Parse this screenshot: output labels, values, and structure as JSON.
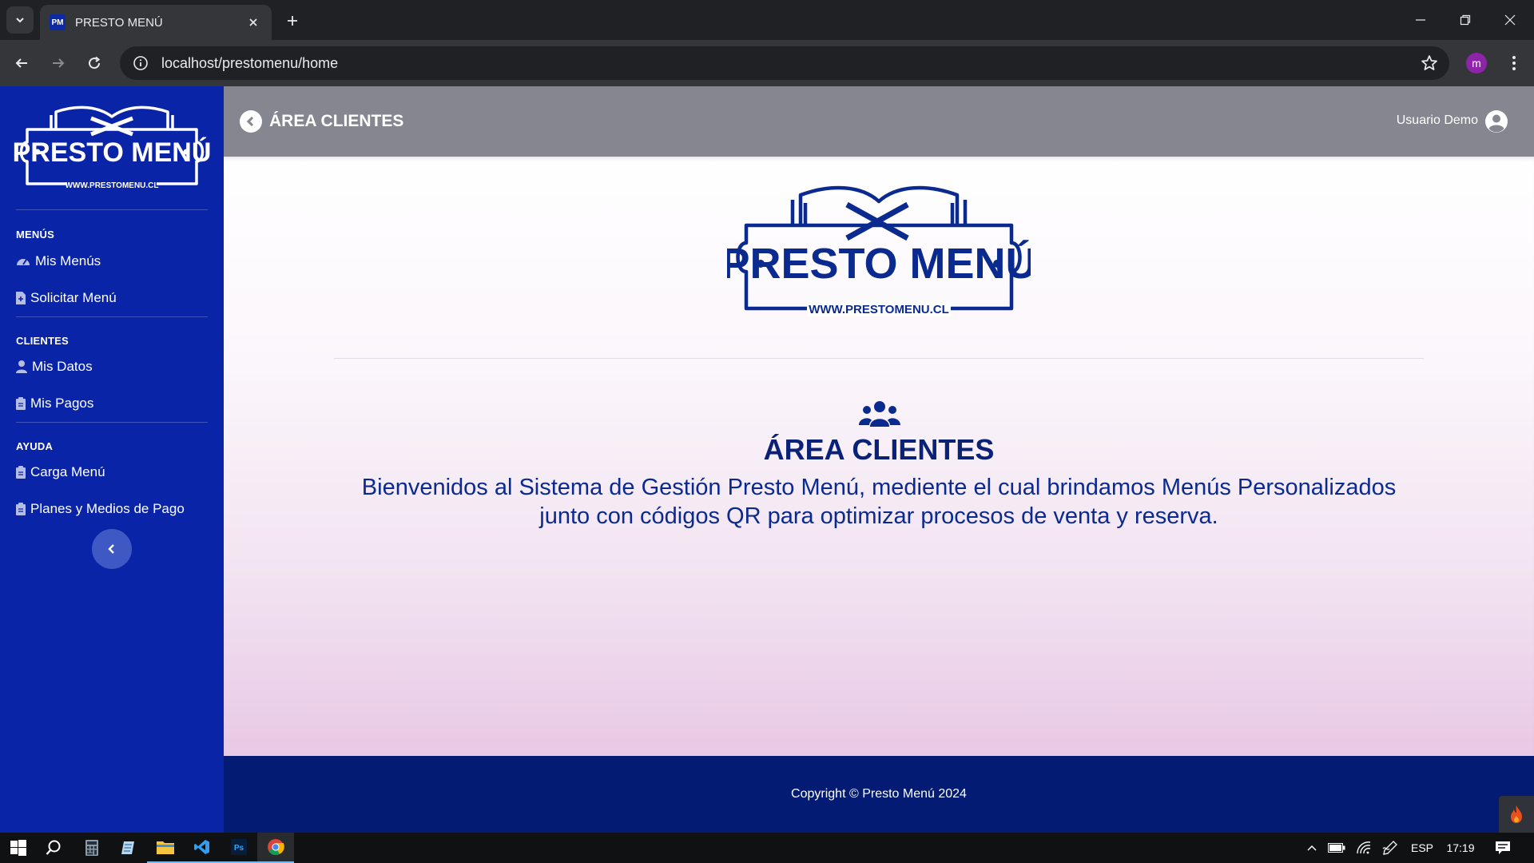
{
  "browser": {
    "tab_title": "PRESTO MENÚ",
    "favicon_text": "PM",
    "url": "localhost/prestomenu/home",
    "profile_initial": "m"
  },
  "brand": {
    "logo_title": "PRESTO MENÚ",
    "logo_url": "WWW.PRESTOMENU.CL",
    "primary_color": "#0a24a8",
    "footer_color": "#031b73",
    "heading_color": "#0a2178"
  },
  "sidebar": {
    "sections": [
      {
        "heading": "MENÚS",
        "items": [
          {
            "label": "Mis Menús",
            "icon": "gauge-icon"
          },
          {
            "label": "Solicitar Menú",
            "icon": "file-plus-icon"
          }
        ]
      },
      {
        "heading": "CLIENTES",
        "items": [
          {
            "label": "Mis Datos",
            "icon": "user-icon"
          },
          {
            "label": "Mis Pagos",
            "icon": "clipboard-icon"
          }
        ]
      },
      {
        "heading": "AYUDA",
        "items": [
          {
            "label": "Carga Menú",
            "icon": "clipboard-icon"
          },
          {
            "label": "Planes y Medios de Pago",
            "icon": "clipboard-icon"
          }
        ]
      }
    ]
  },
  "topbar": {
    "title": "ÁREA CLIENTES",
    "user_name": "Usuario Demo"
  },
  "main": {
    "title": "ÁREA CLIENTES",
    "welcome_line1": "Bienvenidos al Sistema de Gestión Presto Menú, mediente el cual brindamos Menús Personalizados",
    "welcome_line2": "junto con códigos QR para optimizar procesos de venta y reserva."
  },
  "footer": {
    "copyright": "Copyright © Presto Menú 2024"
  },
  "taskbar": {
    "language": "ESP",
    "time": "17:19"
  }
}
